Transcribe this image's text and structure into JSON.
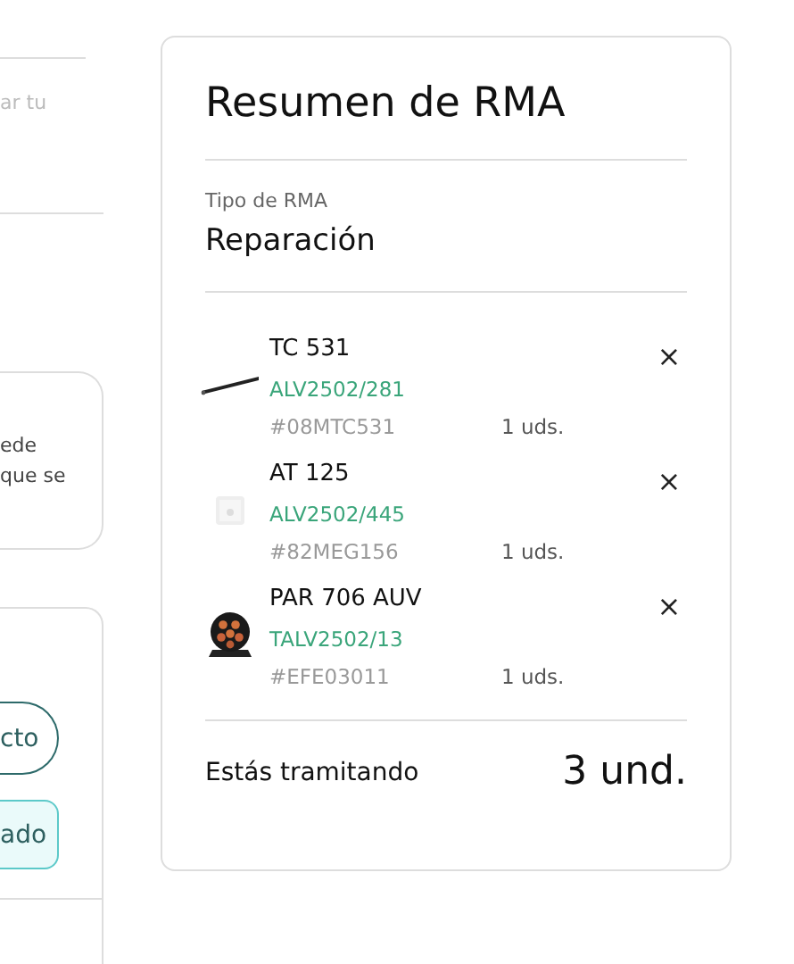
{
  "left_panel": {
    "field_hint": "ar tu",
    "notice": [
      "ede",
      "que se"
    ],
    "options": [
      {
        "label": "cto",
        "selected": false
      },
      {
        "label": "ado",
        "selected": true
      }
    ]
  },
  "summary": {
    "title": "Resumen de RMA",
    "type_label": "Tipo de RMA",
    "type_value": "Reparación",
    "items": [
      {
        "name": "TC 531",
        "order": "ALV2502/281",
        "sku": "#08MTC531",
        "qty": "1 uds.",
        "remove": "×"
      },
      {
        "name": "AT 125",
        "order": "ALV2502/445",
        "sku": "#82MEG156",
        "qty": "1 uds.",
        "remove": "×"
      },
      {
        "name": "PAR 706 AUV",
        "order": "TALV2502/13",
        "sku": "#EFE03011",
        "qty": "1 uds.",
        "remove": "×"
      }
    ],
    "footer_label": "Estás tramitando",
    "footer_total": "3 und."
  }
}
